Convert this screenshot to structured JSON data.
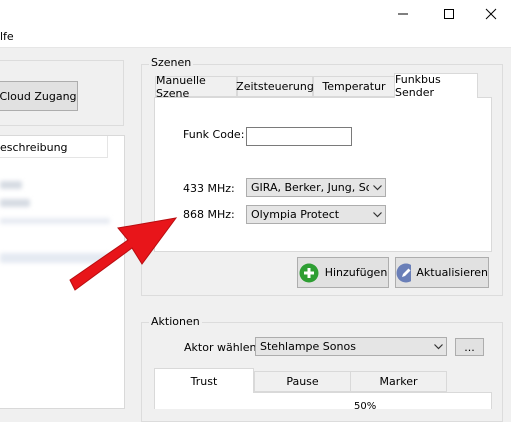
{
  "menu": {
    "help_partial": "lfe"
  },
  "left": {
    "cloud_button": "Cloud Zugang",
    "list_header": "eschreibung"
  },
  "szenen": {
    "group_title": "Szenen",
    "tabs": [
      {
        "label": "Manuelle Szene"
      },
      {
        "label": "Zeitsteuerung"
      },
      {
        "label": "Temperatur"
      },
      {
        "label": "Funkbus Sender"
      }
    ],
    "funk_code_label": "Funk Code:",
    "funk_code_value": "",
    "mhz433_label": "433 MHz:",
    "mhz433_value": "GIRA, Berker, Jung, Somfy",
    "mhz868_label": "868 MHz:",
    "mhz868_value": "Olympia Protect",
    "add_button": "Hinzufügen",
    "update_button": "Aktualisieren"
  },
  "aktionen": {
    "group_title": "Aktionen",
    "actor_label": "Aktor wählen:",
    "actor_value": "Stehlampe Sonos",
    "more_button": "...",
    "tabs": [
      {
        "label": "Trust"
      },
      {
        "label": "Pause"
      },
      {
        "label": "Marker"
      }
    ],
    "percent_text": "50%"
  },
  "colors": {
    "arrow": "#e8151a",
    "add_icon": "#2e9e33",
    "edit_icon": "#6a7fb8"
  }
}
